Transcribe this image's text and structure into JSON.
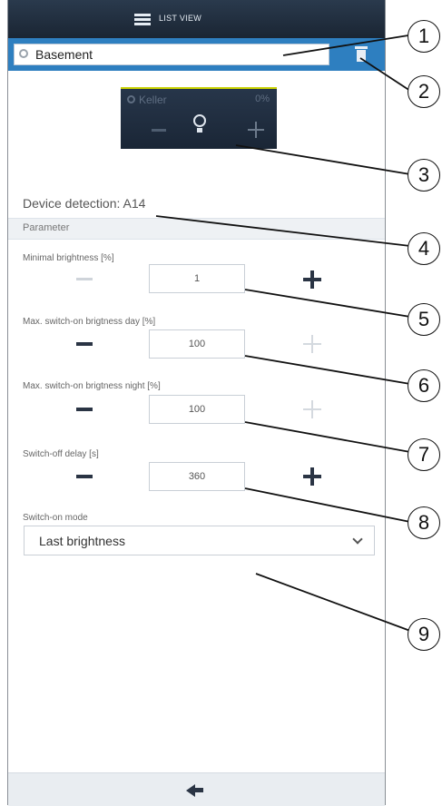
{
  "header": {
    "title": "LIST VIEW"
  },
  "room": {
    "name": "Basement"
  },
  "tile": {
    "name": "Keller",
    "percent": "0%"
  },
  "device": {
    "detection": "Device detection: A14"
  },
  "parameters": {
    "heading": "Parameter",
    "rows": [
      {
        "label": "Minimal brightness [%]",
        "value": "1",
        "minus_enabled": false,
        "plus_enabled": true
      },
      {
        "label": "Max. switch-on brigtness day [%]",
        "value": "100",
        "minus_enabled": true,
        "plus_enabled": false
      },
      {
        "label": "Max. switch-on brigtness night [%]",
        "value": "100",
        "minus_enabled": true,
        "plus_enabled": false
      },
      {
        "label": "Switch-off delay [s]",
        "value": "360",
        "minus_enabled": true,
        "plus_enabled": true
      }
    ],
    "mode_label": "Switch-on mode",
    "mode_value": "Last brightness"
  },
  "callouts": [
    "1",
    "2",
    "3",
    "4",
    "5",
    "6",
    "7",
    "8",
    "9"
  ]
}
